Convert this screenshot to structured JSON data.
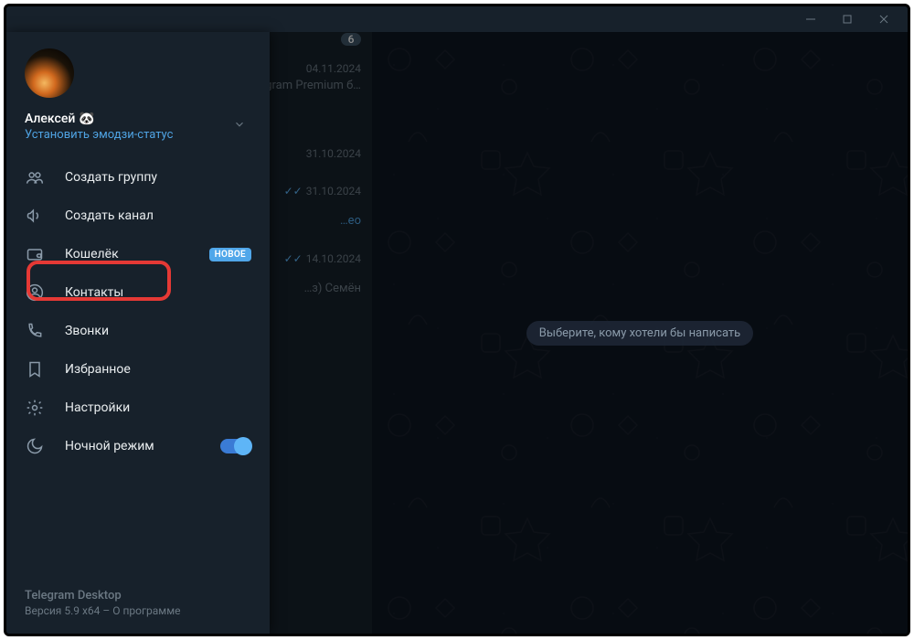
{
  "window": {
    "minimize": "—",
    "maximize": "▢",
    "close": "✕"
  },
  "profile": {
    "name": "Алексей",
    "emoji": "🐼",
    "status_link": "Установить эмодзи-статус"
  },
  "menu": {
    "new_group": "Создать группу",
    "new_channel": "Создать канал",
    "wallet": "Кошелёк",
    "wallet_badge": "НОВОЕ",
    "contacts": "Контакты",
    "calls": "Звонки",
    "saved": "Избранное",
    "settings": "Настройки",
    "night_mode": "Ночной режим"
  },
  "chatlist": {
    "items": [
      {
        "badge": "6",
        "date": "04.11.2024",
        "snippet": "…gram Premium б…"
      },
      {
        "date": "31.10.2024",
        "snippet": ""
      },
      {
        "date": "31.10.2024",
        "snippet": "…ео",
        "read": true
      },
      {
        "date": "14.10.2024",
        "snippet": "…з) Семён",
        "read": true
      }
    ]
  },
  "chatarea": {
    "placeholder": "Выберите, кому хотели бы написать"
  },
  "footer": {
    "app": "Telegram Desktop",
    "version": "Версия 5.9 x64 – О программе"
  }
}
